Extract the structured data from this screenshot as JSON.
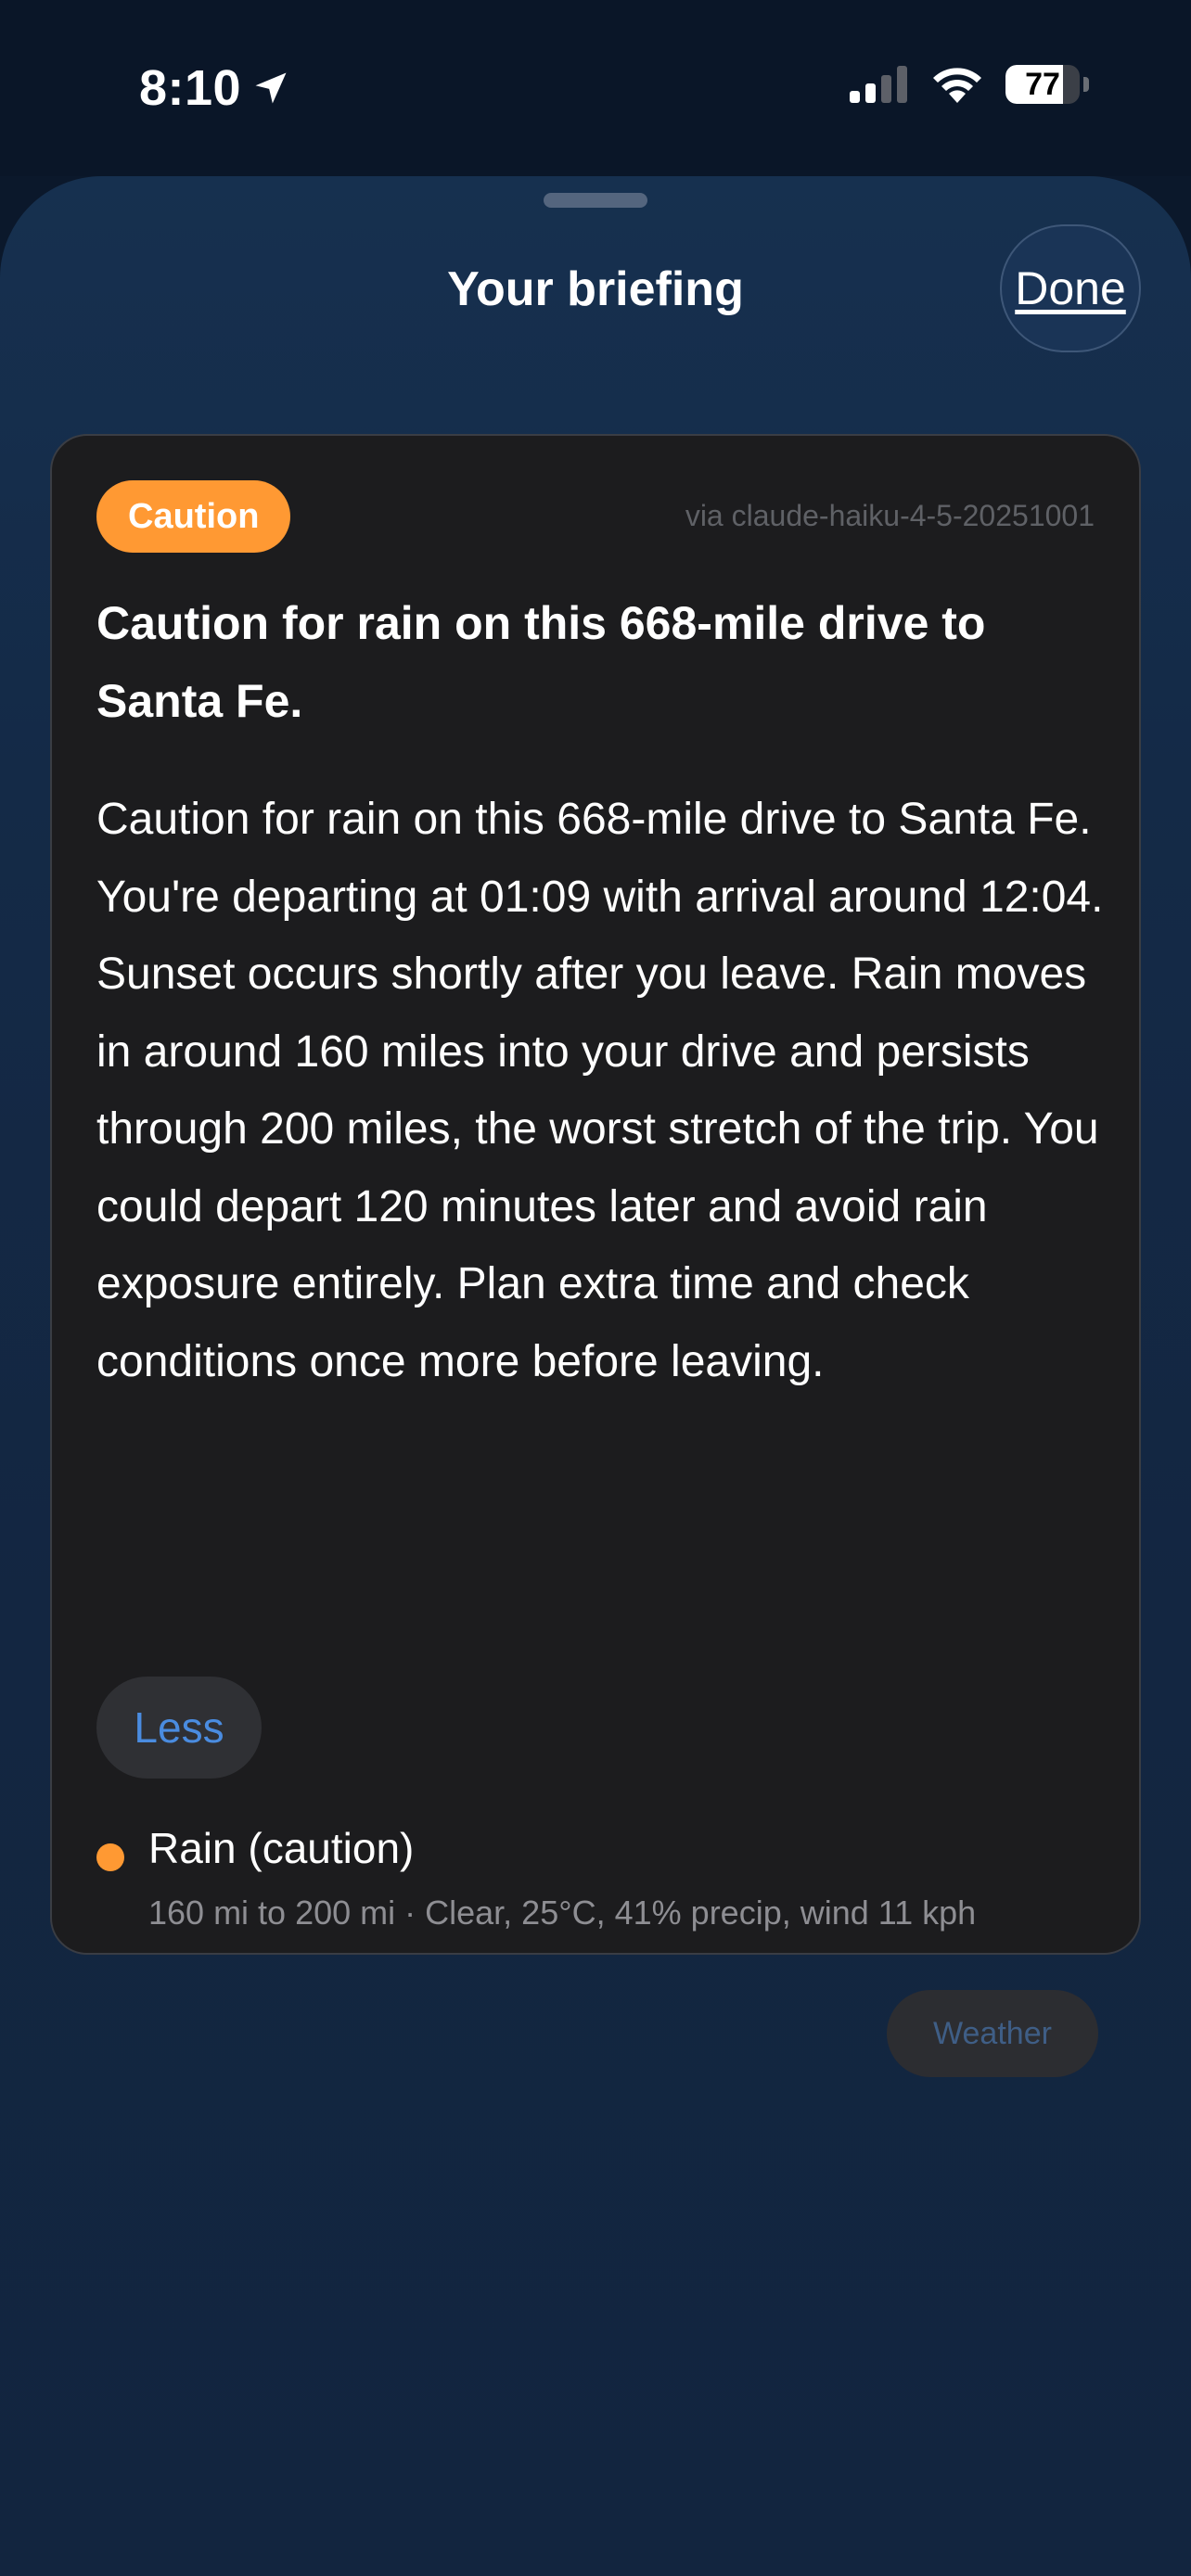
{
  "status_bar": {
    "time": "8:10",
    "battery_level": "77",
    "battery_fraction": 0.77,
    "location_icon": "location-arrow-icon",
    "signal_icon": "cellular-signal-icon",
    "wifi_icon": "wifi-icon"
  },
  "sheet": {
    "title": "Your briefing",
    "done_label": "Done"
  },
  "briefing": {
    "badge": "Caution",
    "badge_color": "#ff9933",
    "model": "via claude-haiku-4-5-20251001",
    "headline": "Caution for rain on this 668-mile drive to Santa Fe.",
    "body": "Caution for rain on this 668-mile drive to Santa Fe. You're departing at 01:09 with arrival around 12:04. Sunset occurs shortly after you leave. Rain moves in around 160 miles into your drive and persists through 200 miles, the worst stretch of the trip. You could depart 120 minutes later and avoid rain exposure entirely. Plan extra time and check conditions once more before leaving.",
    "less_label": "Less",
    "hazards": [
      {
        "title": "Rain (caution)",
        "detail": "160 mi to 200 mi · Clear, 25°C, 41% precip, wind 11 kph",
        "color": "#ff9933"
      }
    ],
    "weather_label": "Weather"
  },
  "colors": {
    "accent_blue": "#4a8ce0",
    "caution_orange": "#ff9933",
    "card_background": "#1c1c1e"
  }
}
